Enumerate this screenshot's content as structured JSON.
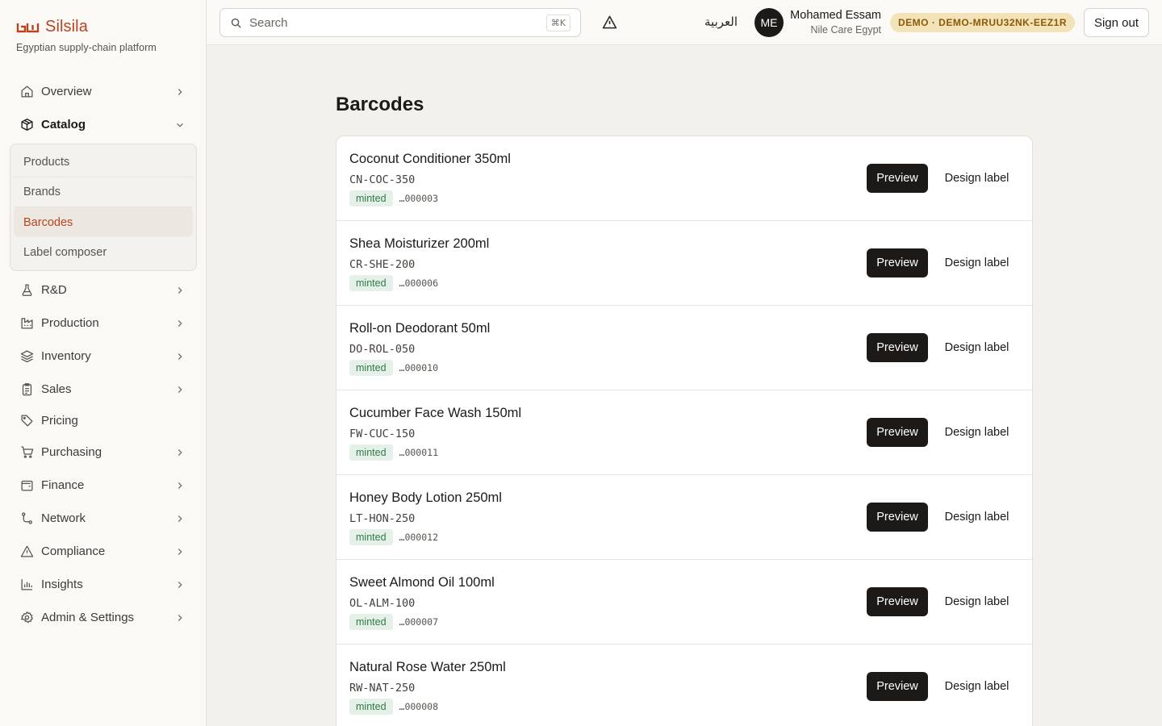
{
  "brand": {
    "name": "Silsila",
    "tagline": "Egyptian supply-chain platform",
    "accent_color": "#b8451f"
  },
  "sidebar": {
    "items": [
      {
        "label": "Overview",
        "icon": "home-icon",
        "has_chevron": true
      },
      {
        "label": "Catalog",
        "icon": "box-icon",
        "expanded": true
      },
      {
        "label": "R&D",
        "icon": "flask-icon",
        "has_chevron": true
      },
      {
        "label": "Production",
        "icon": "factory-icon",
        "has_chevron": true
      },
      {
        "label": "Inventory",
        "icon": "layers-icon",
        "has_chevron": true
      },
      {
        "label": "Sales",
        "icon": "clipboard-icon",
        "has_chevron": true
      },
      {
        "label": "Pricing",
        "icon": "tag-icon",
        "has_chevron": false
      },
      {
        "label": "Purchasing",
        "icon": "cart-icon",
        "has_chevron": true
      },
      {
        "label": "Finance",
        "icon": "wallet-icon",
        "has_chevron": true
      },
      {
        "label": "Network",
        "icon": "route-icon",
        "has_chevron": true
      },
      {
        "label": "Compliance",
        "icon": "warning-icon",
        "has_chevron": true
      },
      {
        "label": "Insights",
        "icon": "bar-chart-icon",
        "has_chevron": true
      },
      {
        "label": "Admin & Settings",
        "icon": "gear-icon",
        "has_chevron": true
      }
    ],
    "catalog_sub": [
      {
        "label": "Products"
      },
      {
        "label": "Brands"
      },
      {
        "label": "Barcodes",
        "active": true
      },
      {
        "label": "Label composer"
      }
    ]
  },
  "topbar": {
    "search_placeholder": "Search",
    "search_shortcut": "⌘K",
    "language": "العربية",
    "user_initials": "ME",
    "user_name": "Mohamed Essam",
    "user_org": "Nile Care Egypt",
    "demo_badge": "DEMO · DEMO-MRUU32NK-EEZ1R",
    "signout_label": "Sign out"
  },
  "main": {
    "title": "Barcodes",
    "preview_label": "Preview",
    "design_label": "Design label",
    "rows": [
      {
        "name": "Coconut Conditioner 350ml",
        "sku": "CN-COC-350",
        "status": "minted",
        "serial": "…000003"
      },
      {
        "name": "Shea Moisturizer 200ml",
        "sku": "CR-SHE-200",
        "status": "minted",
        "serial": "…000006"
      },
      {
        "name": "Roll-on Deodorant 50ml",
        "sku": "DO-ROL-050",
        "status": "minted",
        "serial": "…000010"
      },
      {
        "name": "Cucumber Face Wash 150ml",
        "sku": "FW-CUC-150",
        "status": "minted",
        "serial": "…000011"
      },
      {
        "name": "Honey Body Lotion 250ml",
        "sku": "LT-HON-250",
        "status": "minted",
        "serial": "…000012"
      },
      {
        "name": "Sweet Almond Oil 100ml",
        "sku": "OL-ALM-100",
        "status": "minted",
        "serial": "…000007"
      },
      {
        "name": "Natural Rose Water 250ml",
        "sku": "RW-NAT-250",
        "status": "minted",
        "serial": "…000008"
      }
    ]
  }
}
